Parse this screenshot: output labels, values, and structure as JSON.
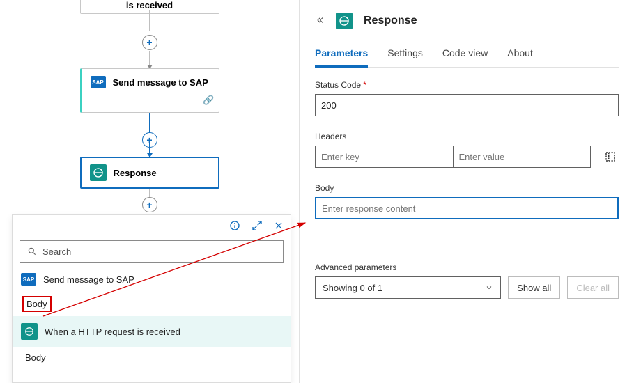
{
  "canvas": {
    "topCard": "is received",
    "sapCard": "Send message to SAP",
    "sapBadge": "SAP",
    "responseCard": "Response",
    "plus": "+"
  },
  "picker": {
    "searchPlaceholder": "Search",
    "items": {
      "sap": "Send message to SAP",
      "bodyLabel": "Body",
      "http": "When a HTTP request is received",
      "httpBody": "Body"
    }
  },
  "panel": {
    "title": "Response",
    "tabs": {
      "parameters": "Parameters",
      "settings": "Settings",
      "codeView": "Code view",
      "about": "About"
    },
    "statusCodeLabel": "Status Code",
    "required": "*",
    "statusCodeValue": "200",
    "headersLabel": "Headers",
    "headerKeyPlaceholder": "Enter key",
    "headerValuePlaceholder": "Enter value",
    "bodyLabel": "Body",
    "bodyPlaceholder": "Enter response content",
    "advancedLabel": "Advanced parameters",
    "advancedSelect": "Showing 0 of 1",
    "showAll": "Show all",
    "clearAll": "Clear all"
  }
}
